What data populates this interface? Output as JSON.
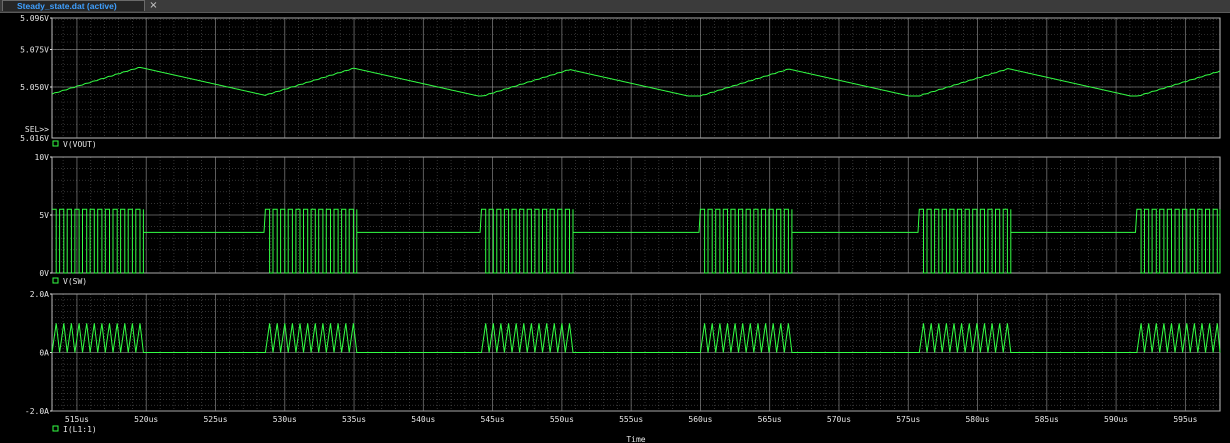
{
  "window": {
    "tab_label": "Steady_state.dat (active)",
    "close_glyph": "×"
  },
  "colors": {
    "background": "#000000",
    "grid": "#9a9a9a",
    "trace": "#33ff44",
    "axis_text": "#e6e6e6",
    "tab_text": "#3fa0ff"
  },
  "chart_data": {
    "type": "line",
    "x_axis": {
      "label": "Time",
      "range_us": [
        513.2,
        597.5
      ],
      "tick_labels": [
        "515us",
        "520us",
        "525us",
        "530us",
        "535us",
        "540us",
        "545us",
        "550us",
        "555us",
        "560us",
        "565us",
        "570us",
        "575us",
        "580us",
        "585us",
        "590us",
        "595us"
      ],
      "tick_values": [
        515,
        520,
        525,
        530,
        535,
        540,
        545,
        550,
        555,
        560,
        565,
        570,
        575,
        580,
        585,
        590,
        595
      ]
    },
    "switching_bursts_us": [
      [
        513.2,
        519.6
      ],
      [
        528.6,
        535.0
      ],
      [
        544.2,
        550.6
      ],
      [
        560.0,
        566.4
      ],
      [
        575.8,
        582.2
      ],
      [
        591.5,
        597.5
      ]
    ],
    "plots": [
      {
        "series": "V(VOUT)",
        "unit": "V",
        "y_range": [
          5.016,
          5.096
        ],
        "y_ticks": [
          5.096,
          5.075,
          5.05
        ],
        "y_tick_labels": [
          "5.096V",
          "5.075V",
          "5.050V"
        ],
        "y_min_label": "5.016V",
        "sel_marker": "SEL>>",
        "values_description_free": true,
        "valley": 5.044,
        "peak": 5.063
      },
      {
        "series": "V(SW)",
        "unit": "V",
        "y_range": [
          0,
          10
        ],
        "y_ticks": [
          10,
          5,
          0
        ],
        "y_tick_labels": [
          "10V",
          "5V",
          "0V"
        ],
        "high": 5.5,
        "low": 0,
        "idle_level": 3.5
      },
      {
        "series": "I(L1:1)",
        "unit": "A",
        "y_range": [
          -2.0,
          2.0
        ],
        "y_ticks": [
          2.0,
          0,
          -2.0
        ],
        "y_tick_labels": [
          "2.0A",
          "0A",
          "-2.0A"
        ],
        "ripple_peak": 1.0,
        "ripple_low": 0.0,
        "idle_level": 0.0
      }
    ]
  }
}
